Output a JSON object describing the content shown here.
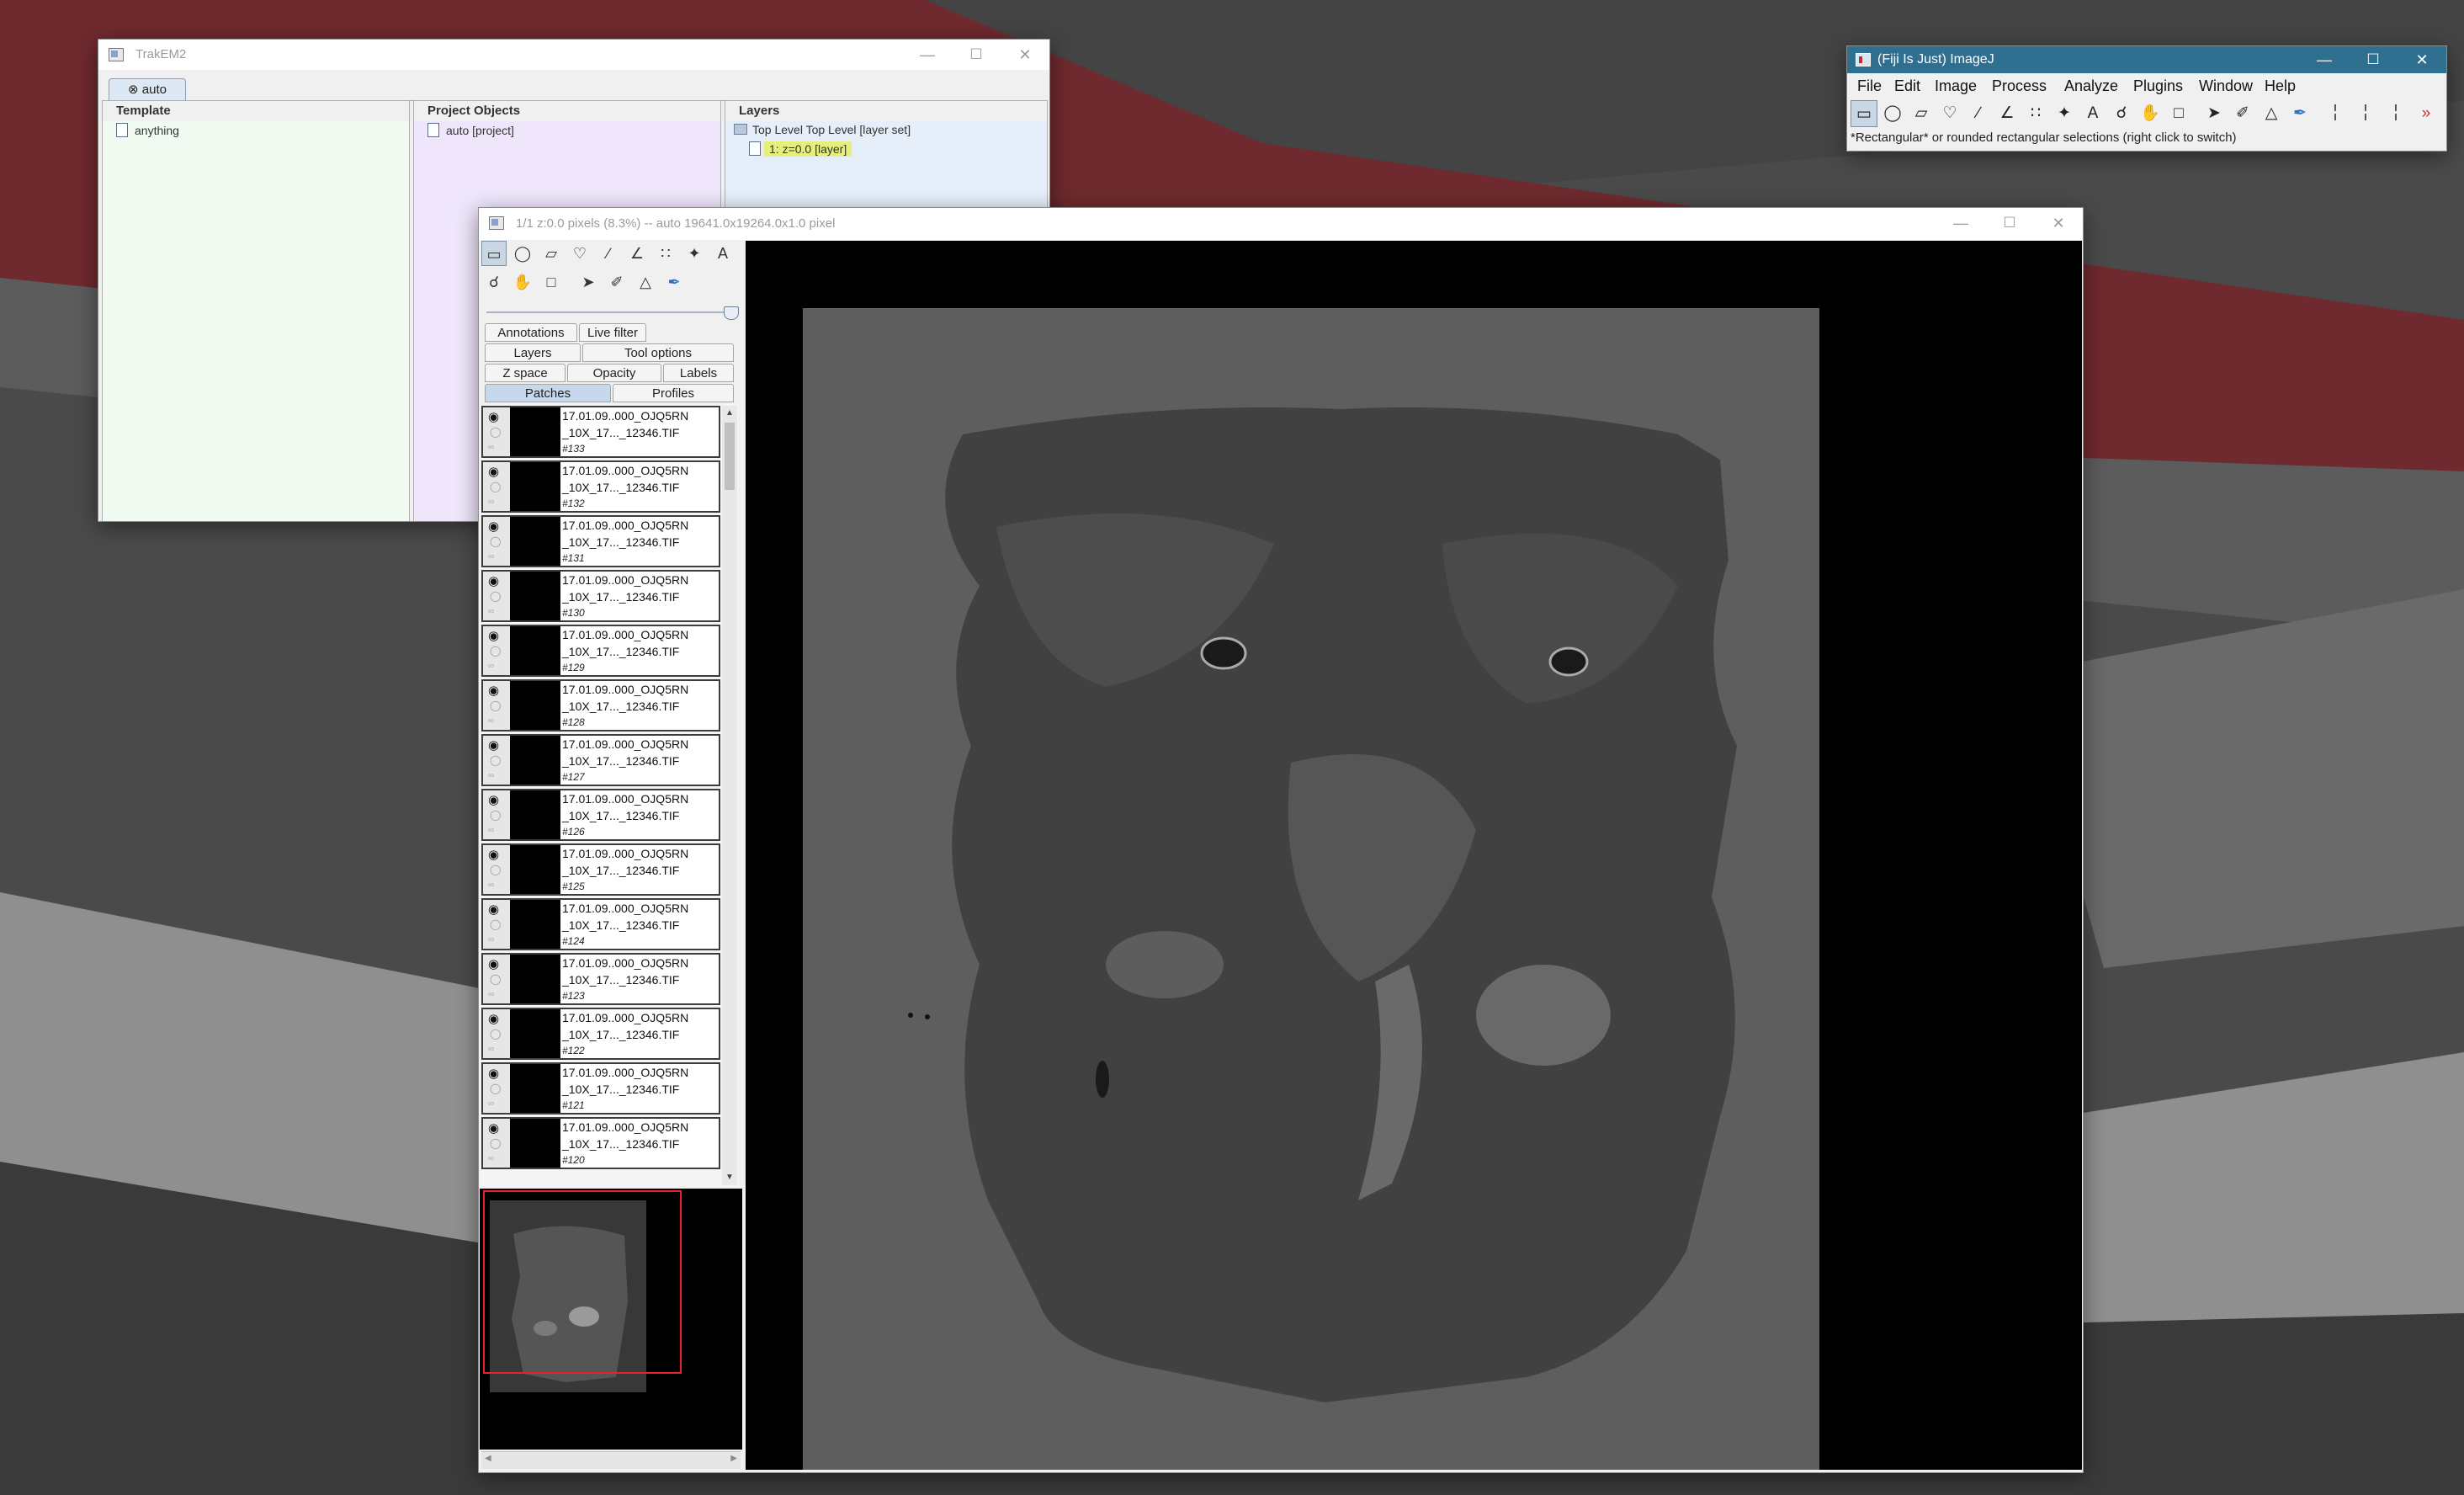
{
  "colors": {
    "wallpaper_dark": "#3d3d3d",
    "wallpaper_red": "#6e2a2e",
    "wallpaper_light": "#9a9a9a",
    "template_pane": "#f2fbf2",
    "objects_pane": "#efe6fb",
    "layers_pane": "#e6eefa",
    "layer_highlight": "#e4f07a",
    "imagej_title": "#2f6f90",
    "navigator_frame": "#e0262a"
  },
  "trakem2": {
    "title": "TrakEM2",
    "project_tab": "auto",
    "template": {
      "header": "Template",
      "items": [
        "anything"
      ]
    },
    "project_objects": {
      "header": "Project Objects",
      "items": [
        "auto [project]"
      ]
    },
    "layers": {
      "header": "Layers",
      "layer_set": "Top Level Top Level [layer set]",
      "layer": "1:  z=0.0 [layer]"
    }
  },
  "display": {
    "title": "1/1  z:0.0 pixels  (8.3%) -- auto  19641.0x19264.0x1.0 pixel",
    "tools_row1": [
      "rectangle-tool",
      "oval-tool",
      "polygon-tool",
      "freehand-tool",
      "line-tool",
      "angle-tool",
      "point-tool",
      "wand-tool",
      "text-tool"
    ],
    "tools_row2": [
      "zoom-tool",
      "hand-tool",
      "box-tool",
      "arrow-tool",
      "pen-tool",
      "brush-tool",
      "pipette-tool"
    ],
    "tabs": {
      "annotations": "Annotations",
      "live_filter": "Live filter",
      "layers": "Layers",
      "tool_options": "Tool options",
      "z_space": "Z space",
      "opacity": "Opacity",
      "labels": "Labels",
      "patches": "Patches",
      "profiles": "Profiles"
    },
    "patches": [
      {
        "line1": "17.01.09..000_OJQ5RN",
        "line2": "_10X_17..._12346.TIF",
        "id": "#133"
      },
      {
        "line1": "17.01.09..000_OJQ5RN",
        "line2": "_10X_17..._12346.TIF",
        "id": "#132"
      },
      {
        "line1": "17.01.09..000_OJQ5RN",
        "line2": "_10X_17..._12346.TIF",
        "id": "#131"
      },
      {
        "line1": "17.01.09..000_OJQ5RN",
        "line2": "_10X_17..._12346.TIF",
        "id": "#130"
      },
      {
        "line1": "17.01.09..000_OJQ5RN",
        "line2": "_10X_17..._12346.TIF",
        "id": "#129"
      },
      {
        "line1": "17.01.09..000_OJQ5RN",
        "line2": "_10X_17..._12346.TIF",
        "id": "#128"
      },
      {
        "line1": "17.01.09..000_OJQ5RN",
        "line2": "_10X_17..._12346.TIF",
        "id": "#127"
      },
      {
        "line1": "17.01.09..000_OJQ5RN",
        "line2": "_10X_17..._12346.TIF",
        "id": "#126"
      },
      {
        "line1": "17.01.09..000_OJQ5RN",
        "line2": "_10X_17..._12346.TIF",
        "id": "#125"
      },
      {
        "line1": "17.01.09..000_OJQ5RN",
        "line2": "_10X_17..._12346.TIF",
        "id": "#124"
      },
      {
        "line1": "17.01.09..000_OJQ5RN",
        "line2": "_10X_17..._12346.TIF",
        "id": "#123"
      },
      {
        "line1": "17.01.09..000_OJQ5RN",
        "line2": "_10X_17..._12346.TIF",
        "id": "#122"
      },
      {
        "line1": "17.01.09..000_OJQ5RN",
        "line2": "_10X_17..._12346.TIF",
        "id": "#121"
      },
      {
        "line1": "17.01.09..000_OJQ5RN",
        "line2": "_10X_17..._12346.TIF",
        "id": "#120"
      }
    ]
  },
  "imagej": {
    "title": "(Fiji Is Just) ImageJ",
    "menus": [
      "File",
      "Edit",
      "Image",
      "Process",
      "Analyze",
      "Plugins",
      "Window",
      "Help"
    ],
    "tools": [
      "rectangle-tool",
      "oval-tool",
      "polygon-tool",
      "freehand-tool",
      "line-tool",
      "angle-tool",
      "point-tool",
      "wand-tool",
      "text-tool",
      "zoom-tool",
      "hand-tool",
      "color-picker-tool",
      "arrow-tool",
      "pencil-tool",
      "flood-fill-tool",
      "brush-tool",
      "more-tools"
    ],
    "status": "*Rectangular* or rounded rectangular selections (right click to switch)"
  }
}
